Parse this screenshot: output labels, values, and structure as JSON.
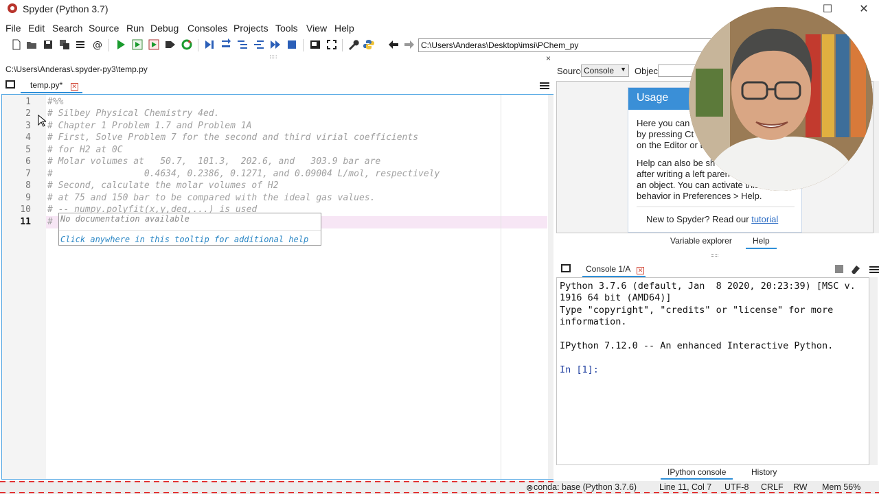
{
  "window": {
    "title": "Spyder (Python 3.7)",
    "minimize_glyph": "",
    "maximize_glyph": "☐",
    "close_glyph": "✕"
  },
  "menu": [
    "File",
    "Edit",
    "Search",
    "Source",
    "Run",
    "Debug",
    "Consoles",
    "Projects",
    "Tools",
    "View",
    "Help"
  ],
  "toolbar": {
    "icons": [
      "new-file-icon",
      "open-folder-icon",
      "save-icon",
      "save-all-icon",
      "list-icon",
      "at-sign-icon",
      "run-icon",
      "run-cell-icon",
      "run-cell-advance-icon",
      "run-selection-icon",
      "rerun-icon",
      "debug-icon",
      "step-icon",
      "step-into-icon",
      "step-return-icon",
      "continue-icon",
      "stop-icon",
      "maximize-pane-icon",
      "fullscreen-icon",
      "wrench-icon",
      "python-path-icon",
      "back-arrow-icon",
      "forward-arrow-icon"
    ],
    "working_dir": "C:\\Users\\Anderas\\Desktop\\imsi\\PChem_py"
  },
  "editor": {
    "file_path": "C:\\Users\\Anderas\\.spyder-py3\\temp.py",
    "tab_label": "temp.py*",
    "current_line": 11,
    "lines": [
      "#%%",
      "# Silbey Physical Chemistry 4ed.",
      "# Chapter 1 Problem 1.7 and Problem 1A",
      "# First, Solve Problem 7 for the second and third virial coefficients",
      "# for H2 at 0C",
      "# Molar volumes at   50.7,  101.3,  202.6, and   303.9 bar are",
      "#                 0.4634, 0.2386, 0.1271, and 0.09004 L/mol, respectively",
      "# Second, calculate the molar volumes of H2",
      "# at 75 and 150 bar to be compared with the ideal gas values.",
      "# -- numpy.polyfit(x,y,deg,...) is used",
      "#"
    ],
    "line_numbers": [
      "1",
      "2",
      "3",
      "4",
      "5",
      "6",
      "7",
      "8",
      "9",
      "10",
      "11"
    ],
    "tooltip": {
      "line1": "No documentation available",
      "line2": "Click anywhere in this tooltip for additional help"
    }
  },
  "help": {
    "source_label": "Source",
    "source_value": "Console",
    "object_label": "Object",
    "usage_title": "Usage",
    "usage_lines": [
      "Here you can",
      "by pressing Ct",
      "on the Editor or t",
      "Help can also be sh",
      "after writing a left paren",
      "an object. You can activate this",
      "behavior in Preferences > Help."
    ],
    "new_to": "New to Spyder? Read our ",
    "tutorial": "tutorial",
    "tabs": [
      "Variable explorer",
      "Help"
    ]
  },
  "console": {
    "tab_label": "Console 1/A",
    "lines": [
      "Python 3.7.6 (default, Jan  8 2020, 20:23:39) [MSC v.",
      "1916 64 bit (AMD64)]",
      "Type \"copyright\", \"credits\" or \"license\" for more",
      "information.",
      "",
      "IPython 7.12.0 -- An enhanced Interactive Python.",
      "",
      "In [1]:"
    ],
    "tabs": [
      "IPython console",
      "History"
    ]
  },
  "status": {
    "conda": "conda: base (Python 3.7.6)",
    "position": "Line 11, Col 7",
    "encoding": "UTF-8",
    "eol": "CRLF",
    "rw": "RW",
    "mem": "Mem 56%"
  },
  "colors": {
    "accent": "#2e8fd8",
    "usage_header": "#3a8fd7",
    "run_green": "#1a9b2e",
    "stop_blue": "#2b5fb8"
  }
}
